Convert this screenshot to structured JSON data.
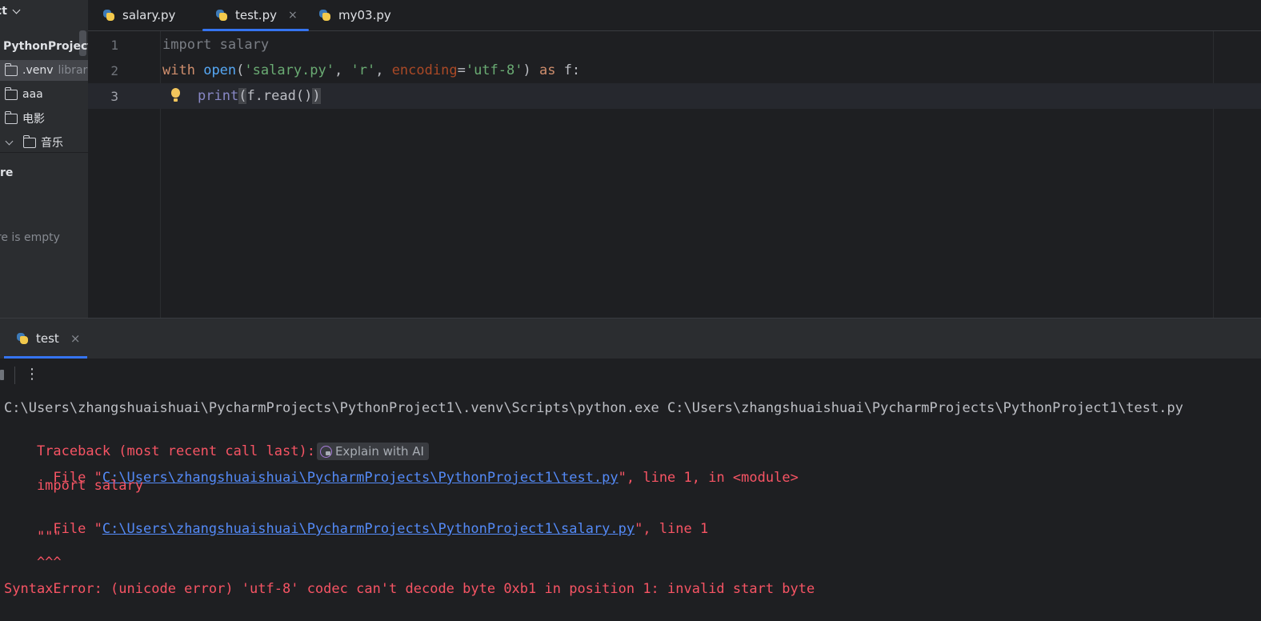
{
  "project_panel": {
    "title": "ct",
    "root": "PythonProject",
    "items": [
      {
        "label": ".venv",
        "hint": "librar"
      },
      {
        "label": "aaa"
      },
      {
        "label": "电影"
      },
      {
        "label": "音乐"
      }
    ],
    "structure_title": "ure",
    "structure_empty": "ure is empty"
  },
  "tabs": [
    {
      "label": "salary.py",
      "active": false
    },
    {
      "label": "test.py",
      "active": true,
      "close": "×"
    },
    {
      "label": "my03.py",
      "active": false
    }
  ],
  "editor": {
    "line_numbers": [
      "1",
      "2",
      "3"
    ],
    "line1": "import salary",
    "line2": {
      "kw_with": "with",
      "fn_open": "open",
      "p1": "(",
      "s1": "'salary.py'",
      "c1": ", ",
      "s2": "'r'",
      "c2": ", ",
      "param": "encoding",
      "eq": "=",
      "s3": "'utf-8'",
      "p2": ") ",
      "kw_as": "as",
      "tail": " f:"
    },
    "line3": {
      "fn_print": "print",
      "lp": "(",
      "mid": "f.read()",
      "rp": ")"
    }
  },
  "run_panel": {
    "tab_label": "test",
    "tab_close": "×",
    "more": "⋮",
    "explain_ai": "Explain with AI",
    "output": {
      "cmd": "C:\\Users\\zhangshuaishuai\\PycharmProjects\\PythonProject1\\.venv\\Scripts\\python.exe C:\\Users\\zhangshuaishuai\\PycharmProjects\\PythonProject1\\test.py",
      "traceback": "Traceback (most recent call last):",
      "file1_prefix": "  File \"",
      "file1_link": "C:\\Users\\zhangshuaishuai\\PycharmProjects\\PythonProject1\\test.py",
      "file1_suffix": "\", line 1, in <module>",
      "code1": "    import salary",
      "file2_prefix": "  File \"",
      "file2_link": "C:\\Users\\zhangshuaishuai\\PycharmProjects\\PythonProject1\\salary.py",
      "file2_suffix": "\", line 1",
      "code2": "    \"\"\"",
      "caret": "    ^^^",
      "error": "SyntaxError: (unicode error) 'utf-8' codec can't decode byte 0xb1 in position 1: invalid start byte"
    }
  }
}
